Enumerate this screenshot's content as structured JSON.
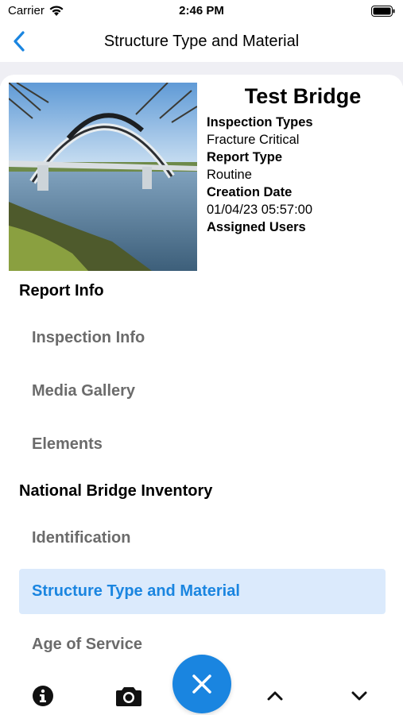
{
  "status_bar": {
    "carrier": "Carrier",
    "time": "2:46 PM"
  },
  "nav": {
    "title": "Structure Type and Material"
  },
  "header": {
    "title": "Test Bridge",
    "fields": [
      {
        "label": "Inspection Types",
        "value": "Fracture Critical"
      },
      {
        "label": "Report Type",
        "value": "Routine"
      },
      {
        "label": "Creation Date",
        "value": "01/04/23 05:57:00"
      },
      {
        "label": "Assigned Users",
        "value": ""
      }
    ]
  },
  "sections": [
    {
      "title": "Report Info",
      "items": [
        "Inspection Info",
        "Media Gallery",
        "Elements"
      ]
    },
    {
      "title": "National Bridge Inventory",
      "items": [
        "Identification",
        "Structure Type and Material",
        "Age of Service"
      ]
    }
  ],
  "selected_item": "Structure Type and Material",
  "toolbar": {
    "icons": [
      "info-icon",
      "camera-icon",
      "close-icon",
      "chevron-up-icon",
      "chevron-down-icon"
    ]
  },
  "colors": {
    "accent": "#1a85e0",
    "selected_bg": "#dbeafc",
    "menu_text": "#6b6b6b",
    "background": "#efeff4"
  }
}
